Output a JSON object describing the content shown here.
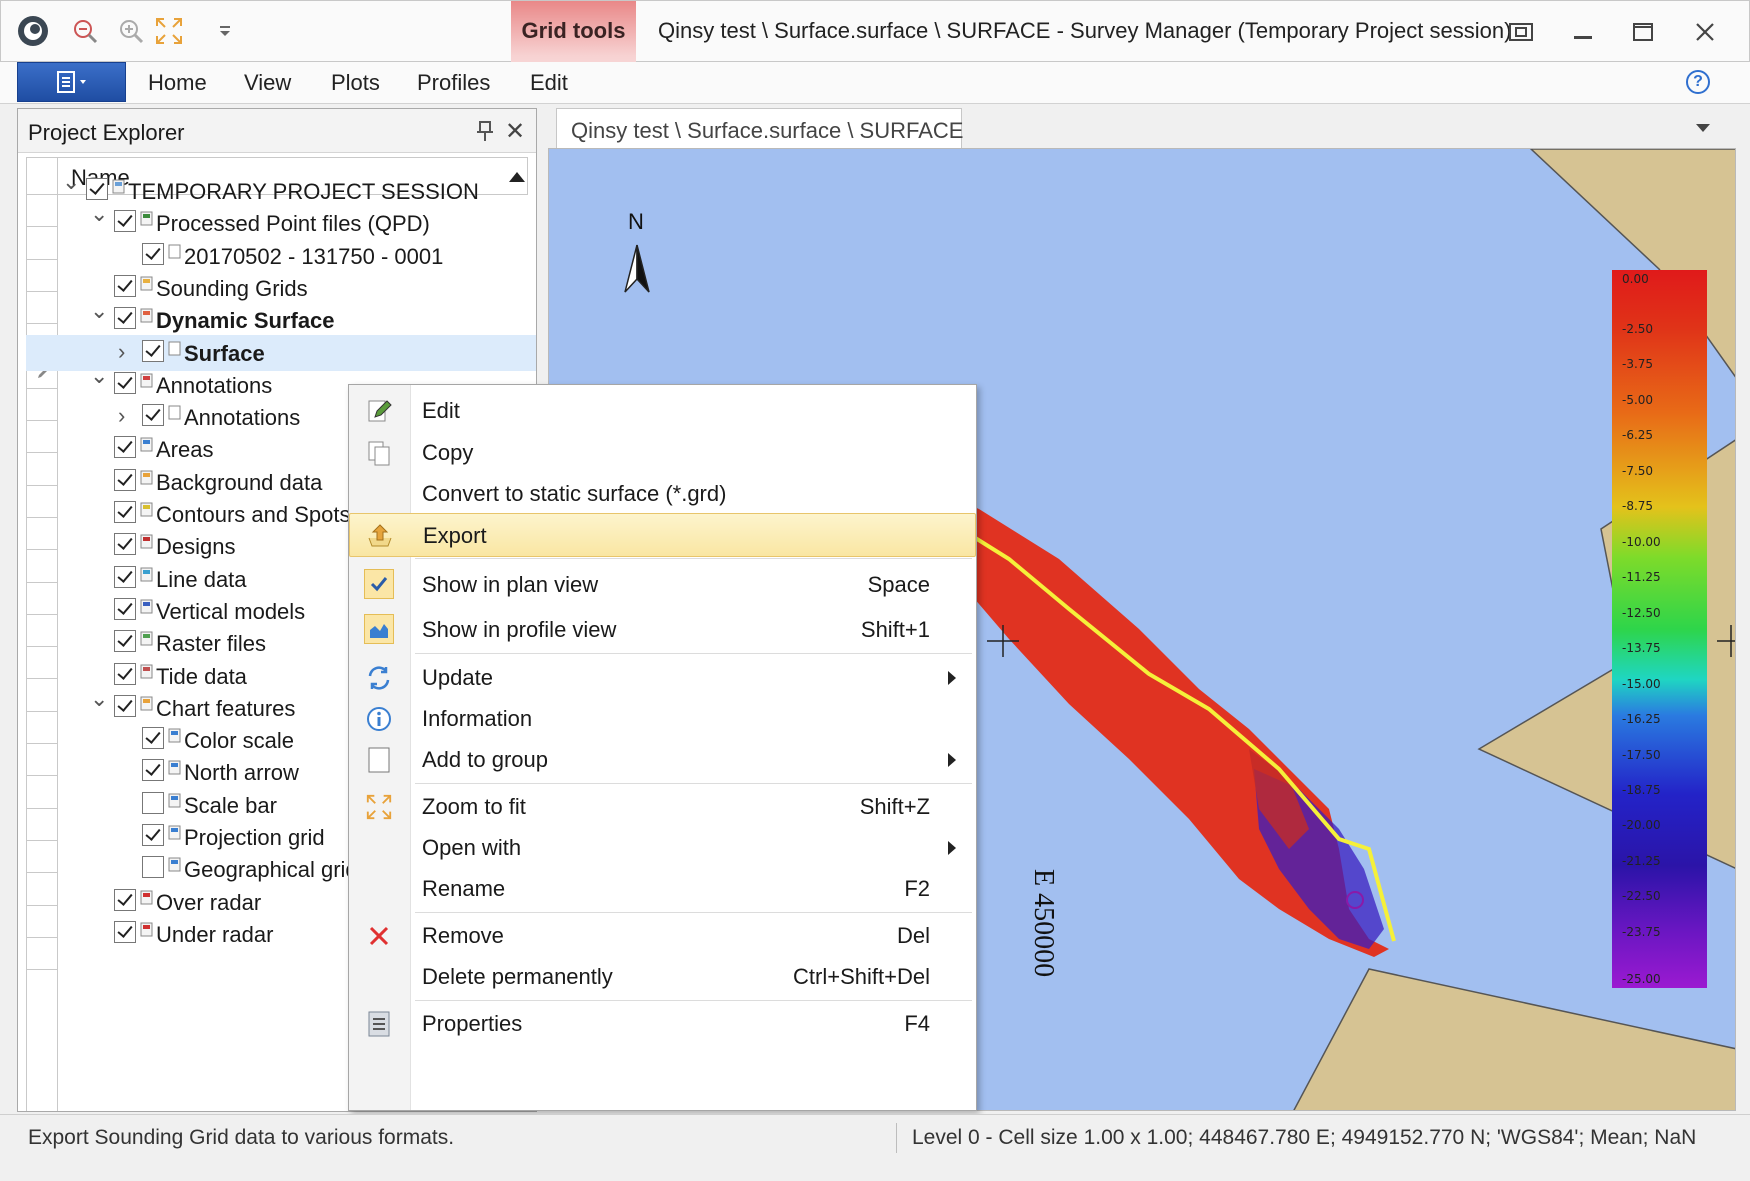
{
  "window": {
    "title": "Qinsy test \\ Surface.surface \\ SURFACE - Survey Manager (Temporary Project session)",
    "contextual_tab_group": "Grid tools"
  },
  "ribbon": {
    "tabs": [
      "Home",
      "View",
      "Plots",
      "Profiles",
      "Edit"
    ]
  },
  "explorer": {
    "title": "Project Explorer",
    "column_header": "Name",
    "items": [
      {
        "label": "TEMPORARY PROJECT SESSION",
        "checked": true,
        "icon": "session-icon"
      },
      {
        "label": "Processed Point files (QPD)",
        "checked": true,
        "icon": "qpd-icon"
      },
      {
        "label": "20170502 - 131750 - 0001",
        "checked": true,
        "icon": "file-icon"
      },
      {
        "label": "Sounding Grids",
        "checked": true,
        "icon": "grid-icon"
      },
      {
        "label": "Dynamic Surface",
        "checked": true,
        "icon": "surface-icon"
      },
      {
        "label": "Surface",
        "checked": true,
        "icon": "file-icon"
      },
      {
        "label": "Annotations",
        "checked": true,
        "icon": "annotation-icon"
      },
      {
        "label": "Annotations",
        "checked": true,
        "icon": "file-icon"
      },
      {
        "label": "Areas",
        "checked": true,
        "icon": "area-icon"
      },
      {
        "label": "Background data",
        "checked": true,
        "icon": "background-icon"
      },
      {
        "label": "Contours and Spots",
        "checked": true,
        "icon": "contour-icon"
      },
      {
        "label": "Designs",
        "checked": true,
        "icon": "design-icon"
      },
      {
        "label": "Line data",
        "checked": true,
        "icon": "line-icon"
      },
      {
        "label": "Vertical models",
        "checked": true,
        "icon": "globe-icon"
      },
      {
        "label": "Raster files",
        "checked": true,
        "icon": "raster-icon"
      },
      {
        "label": "Tide data",
        "checked": true,
        "icon": "tide-icon"
      },
      {
        "label": "Chart features",
        "checked": true,
        "icon": "chart-feature-icon"
      },
      {
        "label": "Color scale",
        "checked": true,
        "icon": "layer-icon"
      },
      {
        "label": "North arrow",
        "checked": true,
        "icon": "layer-icon"
      },
      {
        "label": "Scale bar",
        "checked": false,
        "icon": "layer-icon"
      },
      {
        "label": "Projection grid",
        "checked": true,
        "icon": "layer-icon"
      },
      {
        "label": "Geographical grid",
        "checked": false,
        "icon": "layer-icon"
      },
      {
        "label": "Over radar",
        "checked": true,
        "icon": "radar-icon"
      },
      {
        "label": "Under radar",
        "checked": true,
        "icon": "radar-icon"
      }
    ]
  },
  "document": {
    "tab_label": "Qinsy test \\ Surface.surface \\ SURFACE"
  },
  "map": {
    "north_label": "N",
    "easting_label": "E 450000",
    "legend_labels": [
      "0.00",
      "-2.50",
      "-3.75",
      "-5.00",
      "-6.25",
      "-7.50",
      "-8.75",
      "-10.00",
      "-11.25",
      "-12.50",
      "-13.75",
      "-15.00",
      "-16.25",
      "-17.50",
      "-18.75",
      "-20.00",
      "-21.25",
      "-22.50",
      "-23.75",
      "-25.00"
    ],
    "colors": {
      "water": "#a2bff0",
      "land": "#d6c393",
      "track": "#f5f03a"
    }
  },
  "context_menu": {
    "items": [
      {
        "label": "Edit",
        "shortcut": "",
        "icon": "edit-icon"
      },
      {
        "label": "Copy",
        "shortcut": "",
        "icon": "copy-icon"
      },
      {
        "label": "Convert to static surface (*.grd)",
        "shortcut": "",
        "icon": ""
      },
      {
        "label": "Export",
        "shortcut": "",
        "icon": "export-icon",
        "highlighted": true
      },
      {
        "label": "Show in plan view",
        "shortcut": "Space",
        "icon": "checkmark-icon"
      },
      {
        "label": "Show in profile view",
        "shortcut": "Shift+1",
        "icon": "profile-view-icon"
      },
      {
        "label": "Update",
        "shortcut": "",
        "icon": "refresh-icon",
        "submenu": true
      },
      {
        "label": "Information",
        "shortcut": "",
        "icon": "info-icon"
      },
      {
        "label": "Add to group",
        "shortcut": "",
        "icon": "group-icon",
        "submenu": true
      },
      {
        "label": "Zoom to fit",
        "shortcut": "Shift+Z",
        "icon": "zoom-fit-icon"
      },
      {
        "label": "Open with",
        "shortcut": "",
        "icon": "",
        "submenu": true
      },
      {
        "label": "Rename",
        "shortcut": "F2",
        "icon": ""
      },
      {
        "label": "Remove",
        "shortcut": "Del",
        "icon": "remove-icon"
      },
      {
        "label": "Delete permanently",
        "shortcut": "Ctrl+Shift+Del",
        "icon": ""
      },
      {
        "label": "Properties",
        "shortcut": "F4",
        "icon": "properties-icon"
      }
    ]
  },
  "status": {
    "left": "Export Sounding Grid data to various formats.",
    "right": "Level 0 - Cell size 1.00 x 1.00; 448467.780 E; 4949152.770 N; 'WGS84'; Mean; NaN"
  }
}
